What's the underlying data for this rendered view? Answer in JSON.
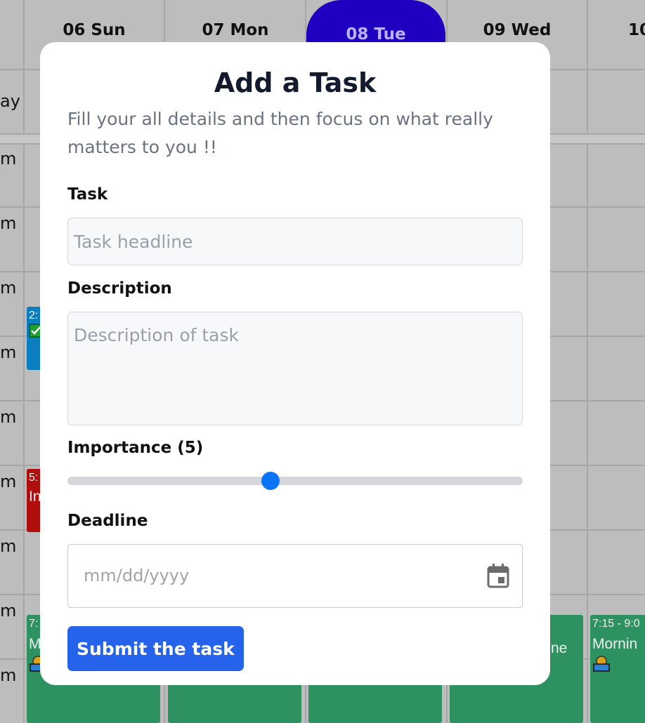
{
  "calendar": {
    "days": [
      "06 Sun",
      "07 Mon",
      "08 Tue",
      "09 Wed",
      "10"
    ],
    "active_day_index": 2,
    "all_day_label": "ay",
    "hour_labels": [
      "m",
      "m",
      "m",
      "m",
      "m",
      "m",
      "m",
      "m",
      "m"
    ],
    "events": [
      {
        "time": "2:",
        "title": "",
        "color": "#0b7ec0",
        "icon": "checkbox-icon"
      },
      {
        "time": "5:",
        "title": "In",
        "color": "#b00d0d",
        "icon": ""
      },
      {
        "time": "7:",
        "title": "M",
        "color": "#2e9160",
        "icon": "sunrise-icon"
      },
      {
        "time": "",
        "title": "",
        "color": "#2e9160",
        "icon": ""
      },
      {
        "time": "",
        "title": "",
        "color": "#2e9160",
        "icon": ""
      },
      {
        "time": "",
        "title": "ne",
        "color": "#2e9160",
        "icon": ""
      },
      {
        "time": "7:15 - 9:0",
        "title": "Mornin",
        "color": "#2e9160",
        "icon": "sunrise-icon"
      }
    ]
  },
  "modal": {
    "title": "Add a Task",
    "subtitle": "Fill your all details and then focus on what really matters to you !!",
    "task_label": "Task",
    "task_placeholder": "Task headline",
    "description_label": "Description",
    "description_placeholder": "Description of task",
    "importance_label": "Importance (5)",
    "importance_value": 5,
    "importance_min": 1,
    "importance_max": 10,
    "deadline_label": "Deadline",
    "deadline_placeholder": "mm/dd/yyyy",
    "submit_label": "Submit the task",
    "accent_color": "#2563eb",
    "slider_color": "#0a74f5"
  }
}
